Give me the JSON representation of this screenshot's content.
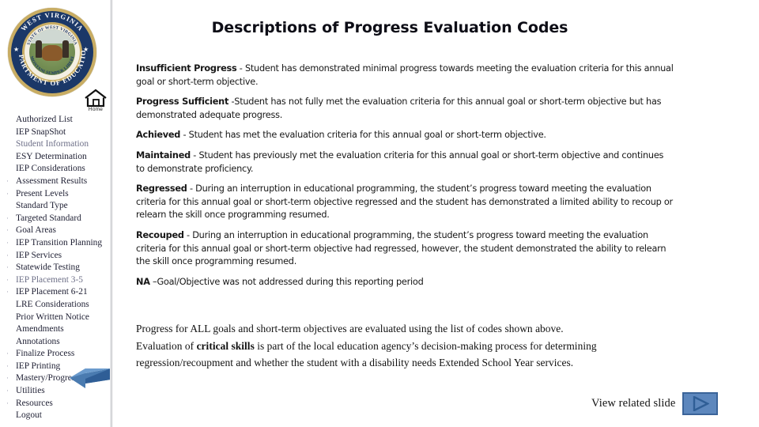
{
  "sidebar": {
    "logo": {
      "name": "west-virginia-department-of-education-seal",
      "outer_text_top": "WEST VIRGINIA",
      "outer_text_bottom": "DEPARTMENT OF EDUCATION",
      "inner_text_top": "STATE OF WEST VIRGINIA",
      "inner_text_bottom": "MONTANI SEMPER LIBERI"
    },
    "home": {
      "label": "Home"
    },
    "items": [
      {
        "label": "Authorized List",
        "bullet": "",
        "faded": false
      },
      {
        "label": "IEP SnapShot",
        "bullet": "",
        "faded": false
      },
      {
        "label": "Student Information",
        "bullet": "",
        "faded": true
      },
      {
        "label": "ESY Determination",
        "bullet": "",
        "faded": false
      },
      {
        "label": "IEP Considerations",
        "bullet": "",
        "faded": false
      },
      {
        "label": "Assessment Results",
        "bullet": "·",
        "faded": false
      },
      {
        "label": "Present Levels",
        "bullet": "·",
        "faded": false
      },
      {
        "label": "Standard Type",
        "bullet": "",
        "faded": false
      },
      {
        "label": "Targeted Standard",
        "bullet": "·",
        "faded": false
      },
      {
        "label": "Goal Areas",
        "bullet": "·",
        "faded": false
      },
      {
        "label": "IEP Transition Planning",
        "bullet": "·",
        "faded": false
      },
      {
        "label": "IEP Services",
        "bullet": "·",
        "faded": false
      },
      {
        "label": "Statewide Testing",
        "bullet": "·",
        "faded": false
      },
      {
        "label": "IEP Placement 3-5",
        "bullet": "·",
        "faded": true
      },
      {
        "label": "IEP Placement 6-21",
        "bullet": "·",
        "faded": false
      },
      {
        "label": "LRE Considerations",
        "bullet": "",
        "faded": false
      },
      {
        "label": "Prior Written Notice",
        "bullet": "",
        "faded": false
      },
      {
        "label": "Amendments",
        "bullet": "",
        "faded": false
      },
      {
        "label": "Annotations",
        "bullet": "",
        "faded": false
      },
      {
        "label": "Finalize Process",
        "bullet": "·",
        "faded": false
      },
      {
        "label": "IEP Printing",
        "bullet": "·",
        "faded": false
      },
      {
        "label": "Mastery/Progress",
        "bullet": "·",
        "faded": false
      },
      {
        "label": "Utilities",
        "bullet": "·",
        "faded": false
      },
      {
        "label": "Resources",
        "bullet": "·",
        "faded": false
      },
      {
        "label": "Logout",
        "bullet": "",
        "faded": false
      }
    ],
    "highlight_arrow_target": "Mastery/Progress"
  },
  "main": {
    "title": "Descriptions of Progress Evaluation Codes",
    "codes": [
      {
        "term": "Insufficient Progress",
        "body": " - Student has demonstrated minimal progress towards meeting the evaluation criteria for this annual goal or short-term objective."
      },
      {
        "term": "Progress Sufficient",
        "body": " -Student has not fully met the evaluation criteria for this annual goal or short-term objective but has demonstrated adequate progress."
      },
      {
        "term": "Achieved",
        "body": " - Student has met the evaluation criteria for this annual goal or short-term objective."
      },
      {
        "term": "Maintained",
        "body": " - Student has previously met the evaluation criteria for this annual goal or short-term objective and continues to demonstrate proficiency."
      },
      {
        "term": "Regressed",
        "body": " - During an interruption in educational programming,  the student’s progress toward meeting the evaluation criteria for this annual goal or short-term objective regressed and the student has demonstrated a limited ability to recoup or relearn the skill once programming resumed."
      },
      {
        "term": "Recouped",
        "body": " - During an interruption in educational programming,  the student’s progress toward meeting the evaluation criteria for this annual goal or short-term objective had regressed, however, the student demonstrated the ability to relearn the skill once programming resumed."
      },
      {
        "term": "NA",
        "body": " –Goal/Objective was not addressed during this reporting period"
      }
    ],
    "summary": {
      "line1": "Progress for ALL goals and short-term objectives are evaluated using the list of codes shown above.",
      "line2_pre": "Evaluation of ",
      "line2_bold": "critical skills",
      "line2_post": " is part of the local education agency’s decision-making process for determining",
      "line3": "regression/recoupment and whether the student with a disability needs Extended School Year services."
    },
    "view_related": {
      "label": "View related slide",
      "button_icon": "play-triangle-icon"
    }
  },
  "colors": {
    "seal_navy": "#1b3868",
    "seal_gold": "#c9ad63",
    "arrow_blue": "#4a7bb0",
    "button_blue": "#5d87bd",
    "button_border": "#3b6499",
    "divider_gray": "#c9cace"
  }
}
